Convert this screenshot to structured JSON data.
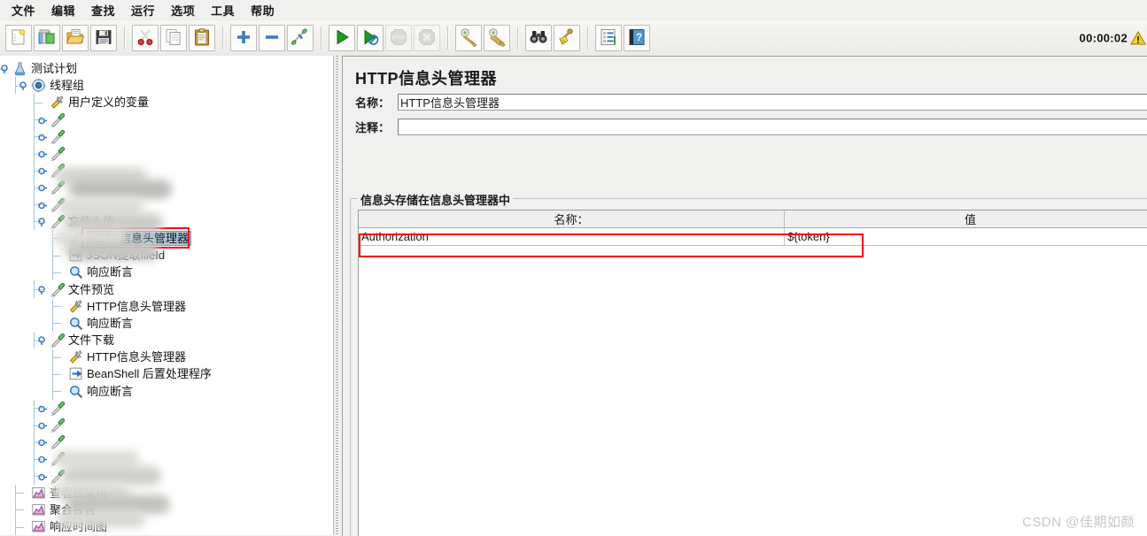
{
  "window": {
    "timer": "00:00:02",
    "watermark": "CSDN @佳期如颜"
  },
  "menubar": {
    "items": [
      {
        "label": "文件",
        "name": "menu-file"
      },
      {
        "label": "编辑",
        "name": "menu-edit"
      },
      {
        "label": "查找",
        "name": "menu-search"
      },
      {
        "label": "运行",
        "name": "menu-run"
      },
      {
        "label": "选项",
        "name": "menu-options"
      },
      {
        "label": "工具",
        "name": "menu-tools"
      },
      {
        "label": "帮助",
        "name": "menu-help"
      }
    ]
  },
  "toolbar": {
    "buttons": [
      {
        "icon": "new-file-icon",
        "name": "new-button",
        "enabled": true
      },
      {
        "icon": "templates-icon",
        "name": "templates-button",
        "enabled": true
      },
      {
        "icon": "open-folder-icon",
        "name": "open-button",
        "enabled": true
      },
      {
        "icon": "save-disk-icon",
        "name": "save-button",
        "enabled": true
      },
      {
        "sep": true
      },
      {
        "icon": "scissors-icon",
        "name": "cut-button",
        "enabled": true
      },
      {
        "icon": "copy-icon",
        "name": "copy-button",
        "enabled": true
      },
      {
        "icon": "clipboard-paste-icon",
        "name": "paste-button",
        "enabled": true
      },
      {
        "sep": true
      },
      {
        "icon": "plus-icon",
        "name": "expand-all-button",
        "enabled": true
      },
      {
        "icon": "minus-icon",
        "name": "collapse-all-button",
        "enabled": true
      },
      {
        "icon": "toggle-icon",
        "name": "toggle-button",
        "enabled": true
      },
      {
        "sep": true
      },
      {
        "icon": "play-icon",
        "name": "start-button",
        "enabled": true
      },
      {
        "icon": "play-no-pause-icon",
        "name": "start-no-pauses-button",
        "enabled": true
      },
      {
        "icon": "stop-icon",
        "name": "stop-button",
        "enabled": false
      },
      {
        "icon": "shutdown-icon",
        "name": "shutdown-button",
        "enabled": false
      },
      {
        "sep": true
      },
      {
        "icon": "clear-icon",
        "name": "clear-button",
        "enabled": true
      },
      {
        "icon": "clear-all-icon",
        "name": "clear-all-button",
        "enabled": true
      },
      {
        "sep": true
      },
      {
        "icon": "binoculars-icon",
        "name": "search-button",
        "enabled": true
      },
      {
        "icon": "broom-icon",
        "name": "reset-search-button",
        "enabled": true
      },
      {
        "sep": true
      },
      {
        "icon": "function-helper-icon",
        "name": "function-helper-button",
        "enabled": true
      },
      {
        "icon": "help-book-icon",
        "name": "help-button",
        "enabled": true
      }
    ]
  },
  "tree": {
    "nodes": [
      {
        "label": "测试计划",
        "depth": 0,
        "icon": "test-plan-icon",
        "toggle": "expanded",
        "state": "normal"
      },
      {
        "label": "线程组",
        "depth": 1,
        "icon": "thread-group-icon",
        "toggle": "expanded",
        "state": "normal"
      },
      {
        "label": "用户定义的变量",
        "depth": 2,
        "icon": "config-icon",
        "toggle": "none",
        "state": "normal"
      },
      {
        "label": "",
        "depth": 2,
        "icon": "sampler-icon",
        "toggle": "collapsed",
        "state": "blurred"
      },
      {
        "label": "",
        "depth": 2,
        "icon": "sampler-icon",
        "toggle": "collapsed",
        "state": "blurred"
      },
      {
        "label": "",
        "depth": 2,
        "icon": "sampler-icon",
        "toggle": "collapsed",
        "state": "blurred"
      },
      {
        "label": "",
        "depth": 2,
        "icon": "sampler-icon",
        "toggle": "collapsed",
        "state": "blurred"
      },
      {
        "label": "",
        "depth": 2,
        "icon": "sampler-icon",
        "toggle": "collapsed",
        "state": "blurred"
      },
      {
        "label": "",
        "depth": 2,
        "icon": "sampler-icon",
        "toggle": "collapsed",
        "state": "blurred"
      },
      {
        "label": "文件上传",
        "depth": 2,
        "icon": "sampler-icon",
        "toggle": "expanded",
        "state": "normal"
      },
      {
        "label": "HTTP信息头管理器",
        "depth": 3,
        "icon": "config-icon",
        "toggle": "none",
        "state": "selected"
      },
      {
        "label": "JSON提取fileId",
        "depth": 3,
        "icon": "postprocessor-icon",
        "toggle": "none",
        "state": "normal"
      },
      {
        "label": "响应断言",
        "depth": 3,
        "icon": "assertion-icon",
        "toggle": "none",
        "state": "normal"
      },
      {
        "label": "文件预览",
        "depth": 2,
        "icon": "sampler-icon",
        "toggle": "expanded",
        "state": "normal"
      },
      {
        "label": "HTTP信息头管理器",
        "depth": 3,
        "icon": "config-icon",
        "toggle": "none",
        "state": "normal"
      },
      {
        "label": "响应断言",
        "depth": 3,
        "icon": "assertion-icon",
        "toggle": "none",
        "state": "normal"
      },
      {
        "label": "文件下载",
        "depth": 2,
        "icon": "sampler-icon",
        "toggle": "expanded",
        "state": "normal"
      },
      {
        "label": "HTTP信息头管理器",
        "depth": 3,
        "icon": "config-icon",
        "toggle": "none",
        "state": "normal"
      },
      {
        "label": "BeanShell 后置处理程序",
        "depth": 3,
        "icon": "postprocessor-icon",
        "toggle": "none",
        "state": "normal"
      },
      {
        "label": "响应断言",
        "depth": 3,
        "icon": "assertion-icon",
        "toggle": "none",
        "state": "normal"
      },
      {
        "label": "",
        "depth": 2,
        "icon": "sampler-icon",
        "toggle": "collapsed",
        "state": "blurred"
      },
      {
        "label": "",
        "depth": 2,
        "icon": "sampler-icon",
        "toggle": "collapsed",
        "state": "blurred"
      },
      {
        "label": "",
        "depth": 2,
        "icon": "sampler-icon",
        "toggle": "collapsed",
        "state": "blurred"
      },
      {
        "label": "",
        "depth": 2,
        "icon": "sampler-icon",
        "toggle": "collapsed",
        "state": "blurred"
      },
      {
        "label": "",
        "depth": 2,
        "icon": "sampler-icon",
        "toggle": "collapsed",
        "state": "blurred"
      },
      {
        "label": "查看结果树",
        "depth": 1,
        "icon": "listener-icon",
        "toggle": "none",
        "state": "normal"
      },
      {
        "label": "聚合报告",
        "depth": 1,
        "icon": "listener-icon",
        "toggle": "none",
        "state": "normal"
      },
      {
        "label": "响应时间图",
        "depth": 1,
        "icon": "listener-icon",
        "toggle": "none",
        "state": "normal"
      }
    ]
  },
  "panel": {
    "title": "HTTP信息头管理器",
    "name_label": "名称：",
    "name_value": "HTTP信息头管理器",
    "comment_label": "注释：",
    "comment_value": "",
    "group_title": "信息头存储在信息头管理器中",
    "table": {
      "headers": [
        "名称：",
        "值"
      ],
      "rows": [
        {
          "name": "Authorization",
          "value": "${token}"
        }
      ]
    }
  },
  "colors": {
    "highlight_red": "#fb0000",
    "selection_blue": "#b0c4d8",
    "panel_bg": "#f0f0ee",
    "tree_bg": "#ffffff"
  }
}
